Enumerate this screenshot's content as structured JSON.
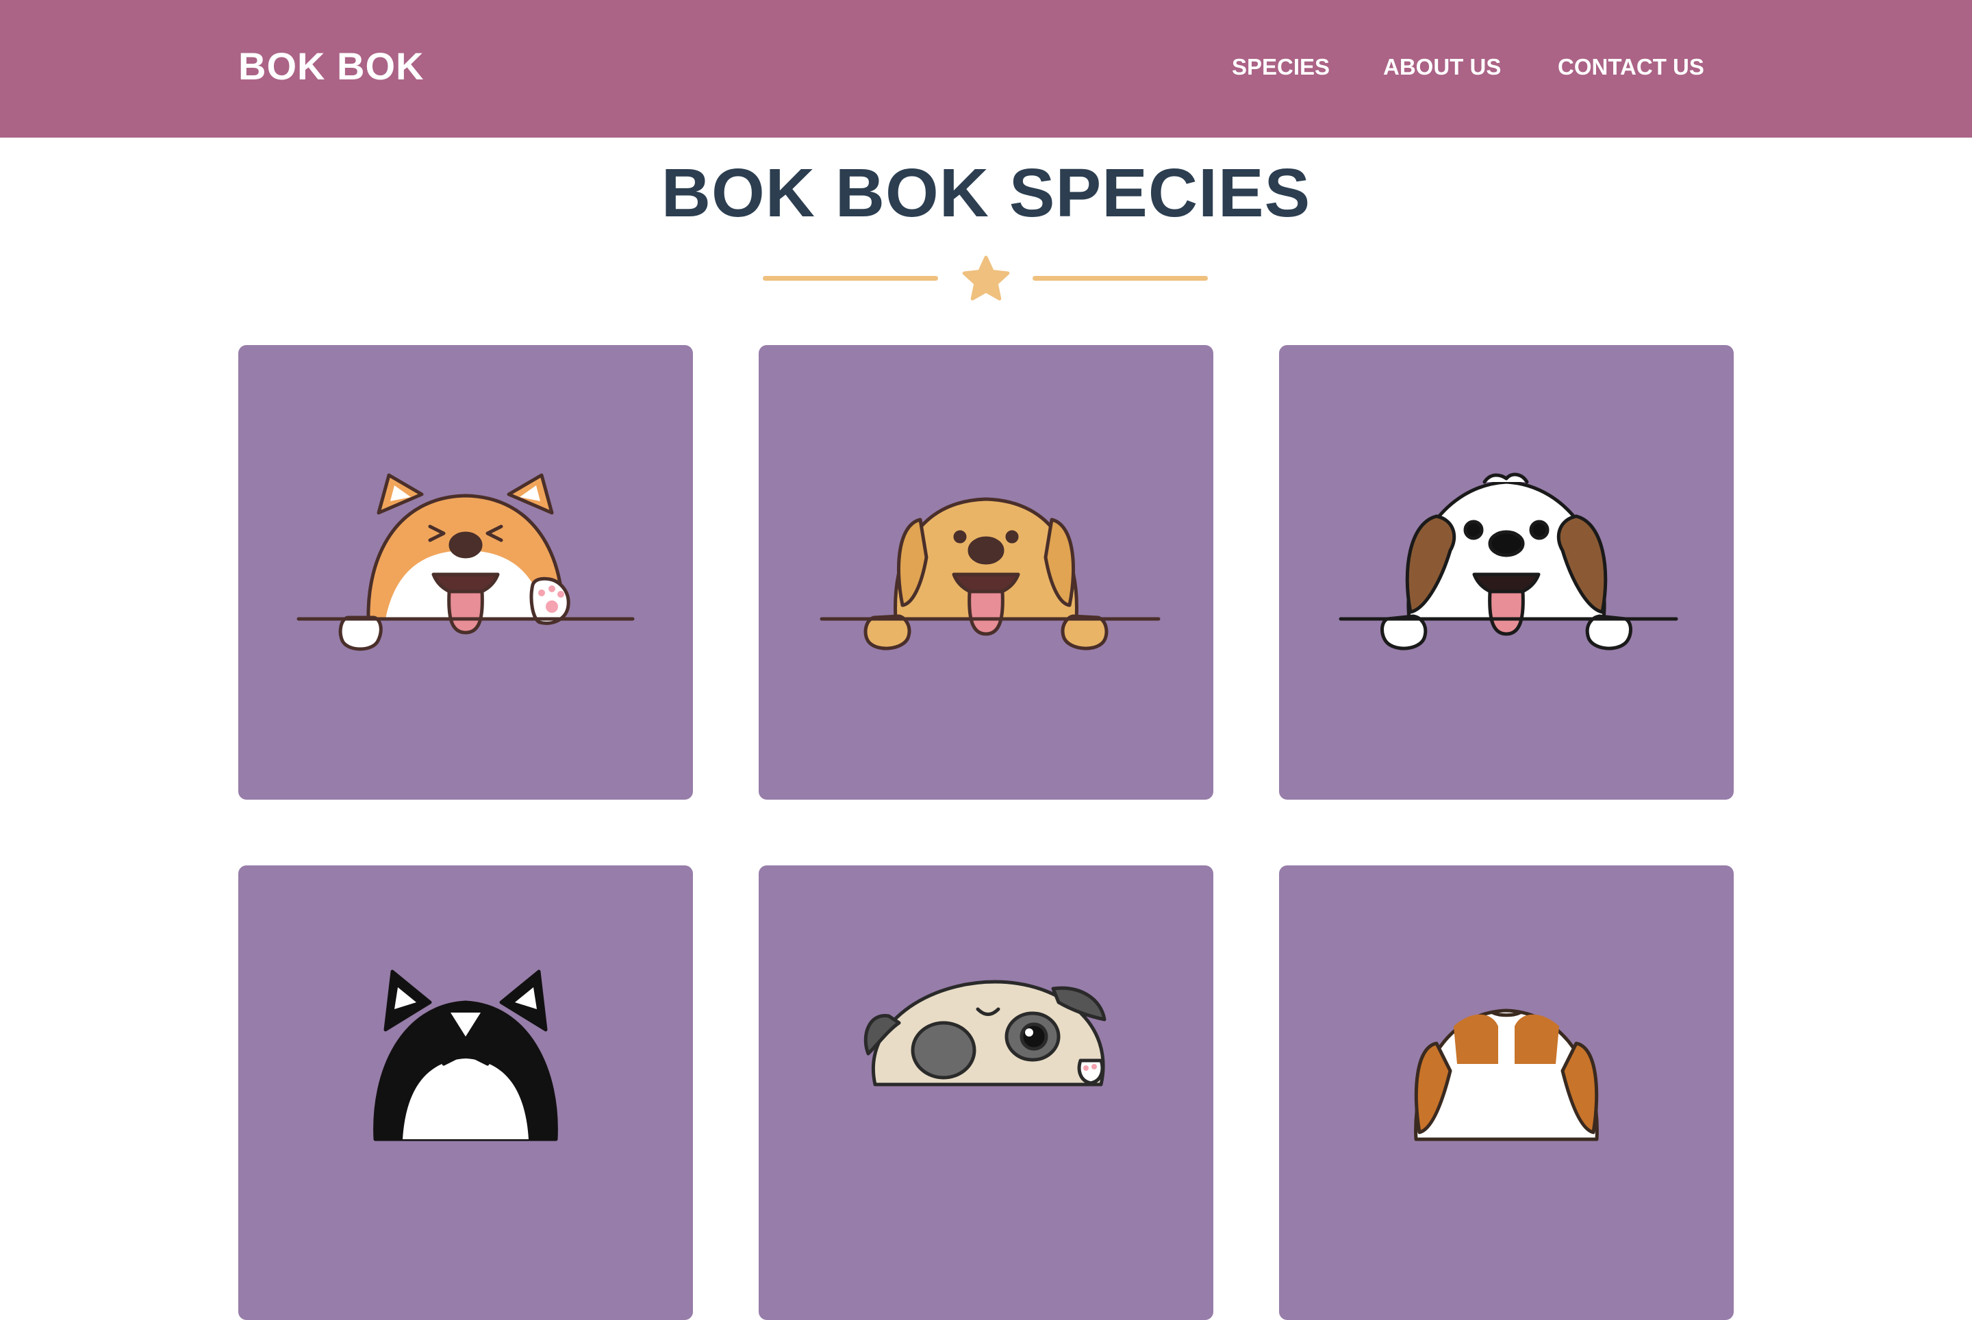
{
  "header": {
    "brand": "BOK BOK",
    "nav": [
      {
        "label": "SPECIES"
      },
      {
        "label": "ABOUT US"
      },
      {
        "label": "CONTACT US"
      }
    ]
  },
  "main": {
    "title": "BOK BOK SPECIES",
    "divider_icon": "star-icon"
  },
  "species_cards": [
    {
      "illustration": "shiba-inu-dog-icon"
    },
    {
      "illustration": "golden-retriever-dog-icon"
    },
    {
      "illustration": "shih-tzu-dog-icon"
    },
    {
      "illustration": "husky-dog-icon"
    },
    {
      "illustration": "pug-dog-icon"
    },
    {
      "illustration": "beagle-dog-icon"
    }
  ],
  "colors": {
    "header_bg": "#ab6386",
    "title": "#2c3e50",
    "accent": "#efc07e",
    "card_bg": "#977da9",
    "header_text": "#ffffff"
  }
}
